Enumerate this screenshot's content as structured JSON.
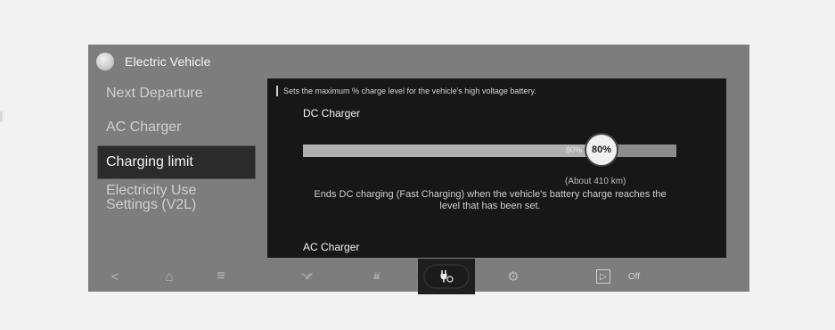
{
  "app": {
    "title": "Electric Vehicle",
    "icon": "ev-app-icon"
  },
  "sidebar": {
    "items": [
      {
        "label": "Next Departure",
        "selected": false
      },
      {
        "label": "AC Charger",
        "selected": false
      },
      {
        "label": "Charging limit",
        "selected": true
      },
      {
        "label_line1": "Electricity Use",
        "label_line2": "Settings (V2L)",
        "selected": false
      }
    ]
  },
  "panel": {
    "description": "Sets the maximum % charge level for the vehicle's high voltage battery.",
    "dc_charger": {
      "title": "DC Charger",
      "value_percent": 80,
      "tick_label": "80%",
      "knob_label": "80%",
      "distance": "(About 410 km)",
      "explanation": "Ends DC charging (Fast Charging) when the vehicle's battery charge reaches the level that has been set."
    },
    "ac_charger": {
      "title": "AC Charger"
    }
  },
  "bottom_bar": {
    "icons": [
      "back-icon",
      "home-icon",
      "menu-icon",
      "eco-leaf-icon",
      "energy-stats-icon",
      "ev-charge-icon",
      "settings-gear-icon",
      "play-icon"
    ],
    "back": "<",
    "home": "⌂",
    "menu": "≡",
    "stats": "ılıl",
    "gear": "⚙",
    "play": "▷",
    "off_label": "Off"
  }
}
